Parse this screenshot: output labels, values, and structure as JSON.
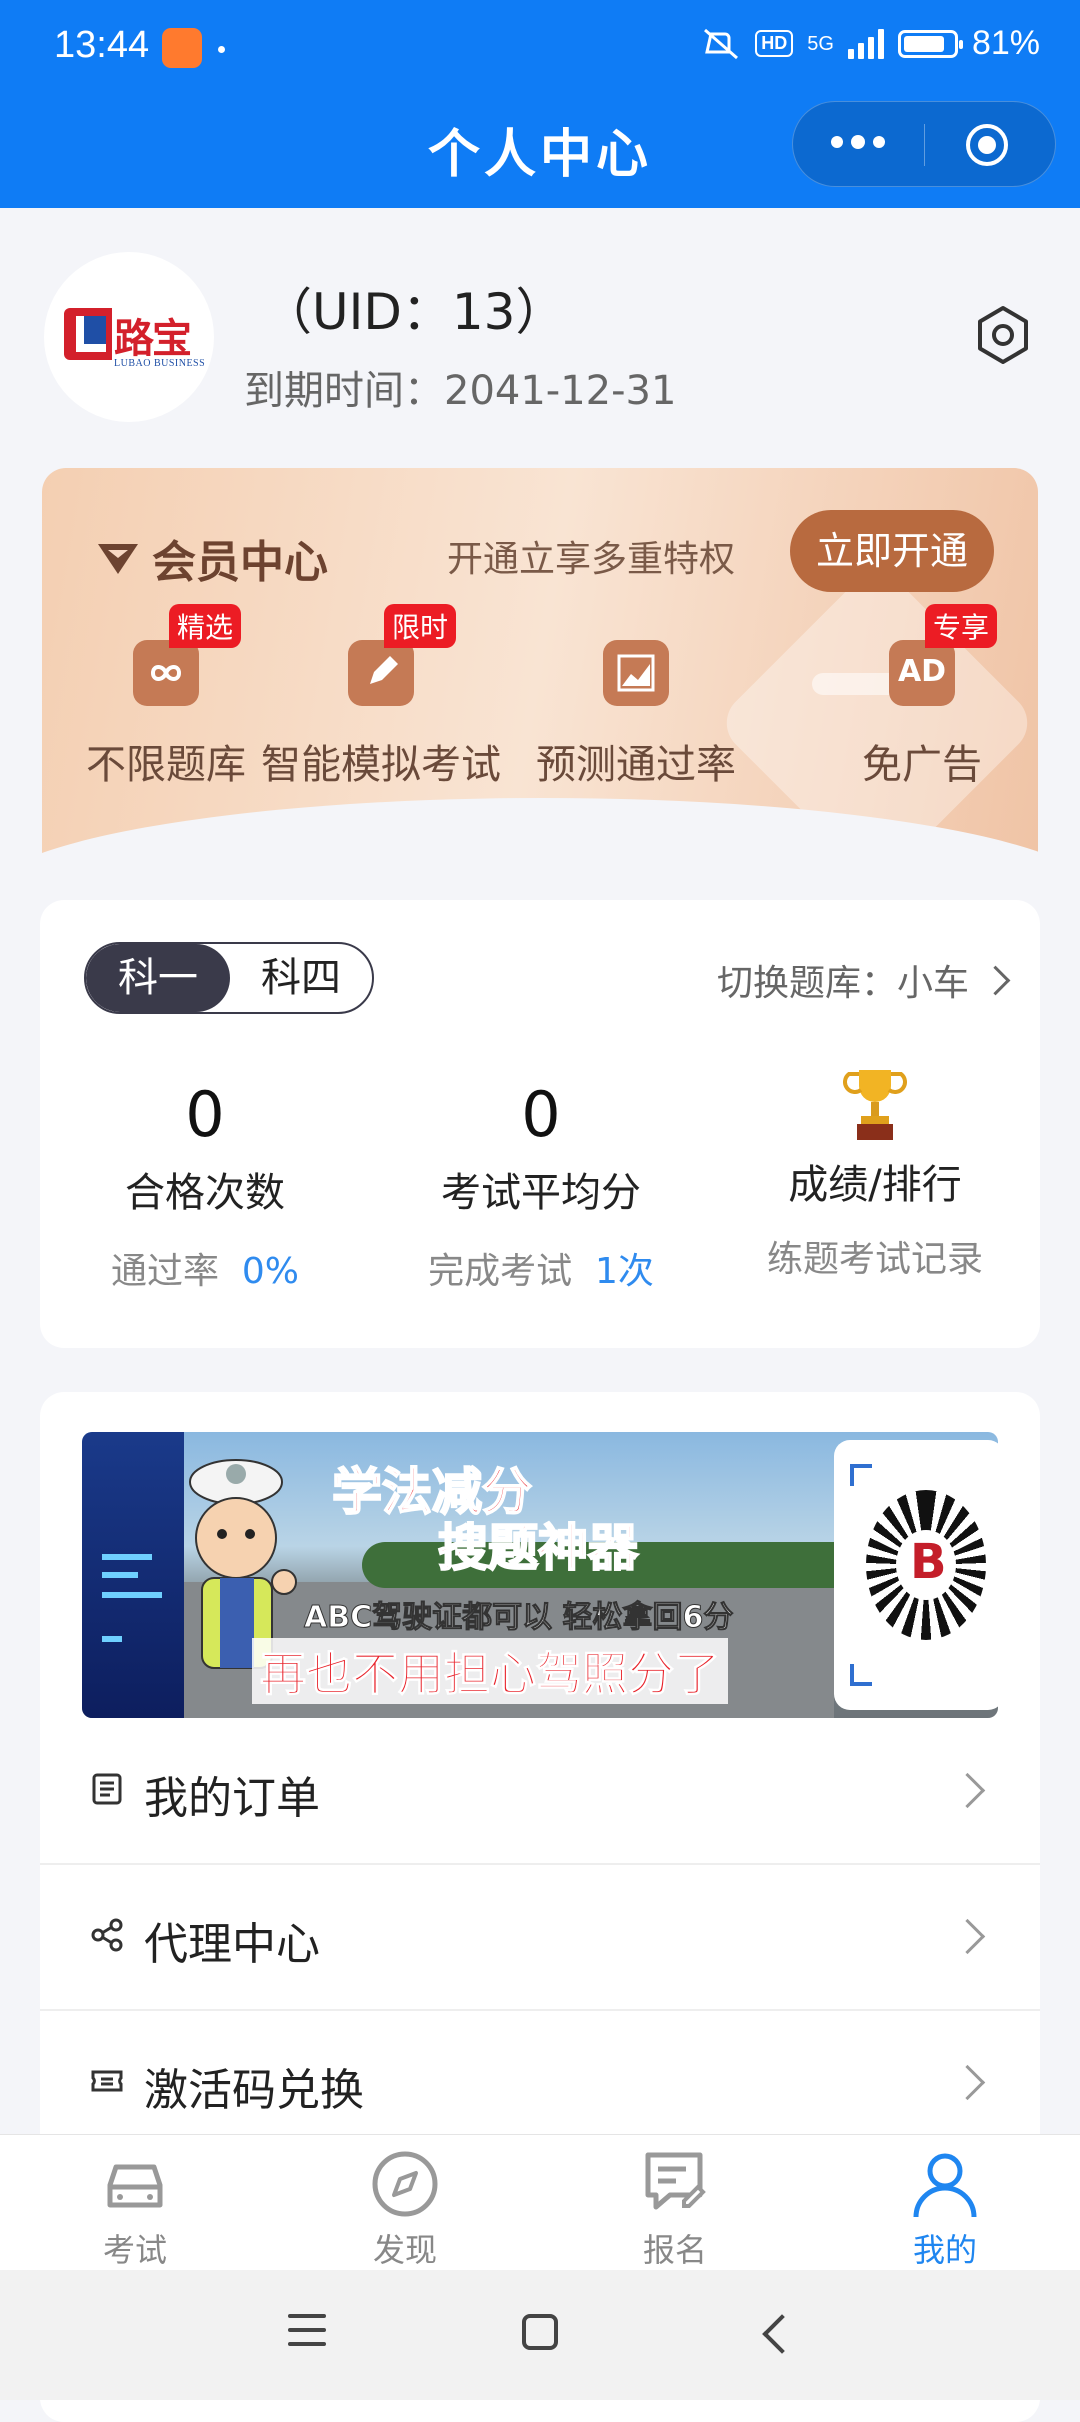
{
  "status_bar": {
    "time": "13:44",
    "network": "5G",
    "hd": "HD",
    "battery": "81%"
  },
  "header": {
    "title": "个人中心"
  },
  "profile": {
    "uid": "（UID：13）",
    "expire": "到期时间：2041-12-31",
    "logo_text": "路宝",
    "logo_sub": "LUBAO BUSINESS"
  },
  "member": {
    "title": "会员中心",
    "promo": "开通立享多重特权",
    "button": "立即开通",
    "features": [
      {
        "label": "不限题库",
        "tag": "精选",
        "icon": "infinity-icon"
      },
      {
        "label": "智能模拟考试",
        "tag": "限时",
        "icon": "pencil-icon"
      },
      {
        "label": "预测通过率",
        "tag": "",
        "icon": "chart-icon"
      },
      {
        "label": "免广告",
        "tag": "专享",
        "icon": "ad-icon",
        "icon_text": "AD"
      }
    ]
  },
  "stats": {
    "subjects": [
      "科一",
      "科四"
    ],
    "switch_label": "切换题库：小车",
    "pass_count": {
      "value": "0",
      "label": "合格次数",
      "sub_label": "通过率",
      "sub_value": "0%"
    },
    "avg_score": {
      "value": "0",
      "label": "考试平均分",
      "sub_label": "完成考试",
      "sub_value": "1次"
    },
    "ranking": {
      "label": "成绩/排行",
      "sub_label": "练题考试记录"
    }
  },
  "banner": {
    "line1": "学法减分",
    "line2": "搜题神器",
    "line3": "ABC驾驶证都可以 轻松拿回6分",
    "line4": "再也不用担心驾照分了"
  },
  "menu_items": [
    {
      "label": "我的订单",
      "icon": "order-list-icon"
    },
    {
      "label": "代理中心",
      "icon": "share-icon"
    },
    {
      "label": "激活码兑换",
      "icon": "ticket-icon"
    }
  ],
  "tabs": [
    {
      "label": "考试",
      "icon": "car-icon",
      "active": false
    },
    {
      "label": "发现",
      "icon": "compass-icon",
      "active": false
    },
    {
      "label": "报名",
      "icon": "signup-icon",
      "active": false
    },
    {
      "label": "我的",
      "icon": "user-icon",
      "active": true
    }
  ],
  "colors": {
    "primary": "#0f7cf5",
    "member_button": "#b86a3f",
    "tag_red": "#ec1c24",
    "accent_blue": "#2f8bef"
  }
}
